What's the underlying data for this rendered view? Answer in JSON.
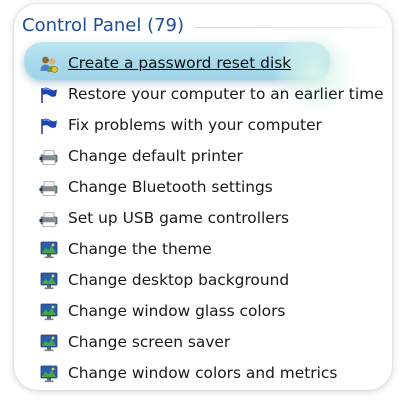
{
  "header": {
    "title": "Control Panel (79)"
  },
  "items": [
    {
      "label": "Create a password reset disk",
      "icon": "users-icon",
      "selected": true
    },
    {
      "label": "Restore your computer to an earlier time",
      "icon": "flag-icon",
      "selected": false
    },
    {
      "label": "Fix problems with your computer",
      "icon": "flag-icon",
      "selected": false
    },
    {
      "label": "Change default printer",
      "icon": "printer-icon",
      "selected": false
    },
    {
      "label": "Change Bluetooth settings",
      "icon": "printer-icon",
      "selected": false
    },
    {
      "label": "Set up USB game controllers",
      "icon": "printer-icon",
      "selected": false
    },
    {
      "label": "Change the theme",
      "icon": "monitor-icon",
      "selected": false
    },
    {
      "label": "Change desktop background",
      "icon": "monitor-icon",
      "selected": false
    },
    {
      "label": "Change window glass colors",
      "icon": "monitor-icon",
      "selected": false
    },
    {
      "label": "Change screen saver",
      "icon": "monitor-icon",
      "selected": false
    },
    {
      "label": "Change window colors and metrics",
      "icon": "monitor-icon",
      "selected": false
    }
  ],
  "colors": {
    "header": "#1e4e9a",
    "highlight": "#a7d9ea"
  }
}
